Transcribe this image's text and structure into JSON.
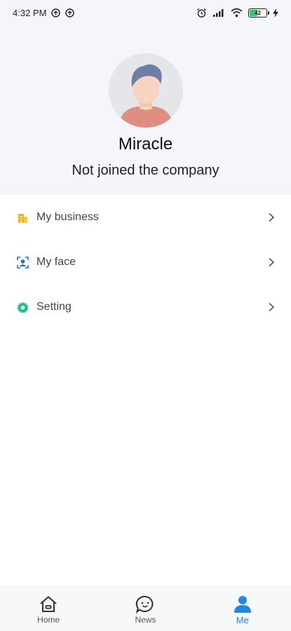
{
  "status_bar": {
    "time": "4:32 PM",
    "battery_level": "42",
    "battery_fraction": 0.42
  },
  "profile": {
    "name": "Miracle",
    "subtitle": "Not joined the company"
  },
  "menu": {
    "items": [
      {
        "label": "My business",
        "icon": "building-icon",
        "color": "#f5b301"
      },
      {
        "label": "My face",
        "icon": "face-scan-icon",
        "color": "#1e6fd9"
      },
      {
        "label": "Setting",
        "icon": "gear-icon",
        "color": "#1fc18a"
      }
    ]
  },
  "bottom_nav": {
    "items": [
      {
        "label": "Home",
        "icon": "home-icon",
        "active": false
      },
      {
        "label": "News",
        "icon": "chat-bubble-icon",
        "active": false
      },
      {
        "label": "Me",
        "icon": "person-icon",
        "active": true
      }
    ],
    "active_color": "#1e88e5"
  }
}
